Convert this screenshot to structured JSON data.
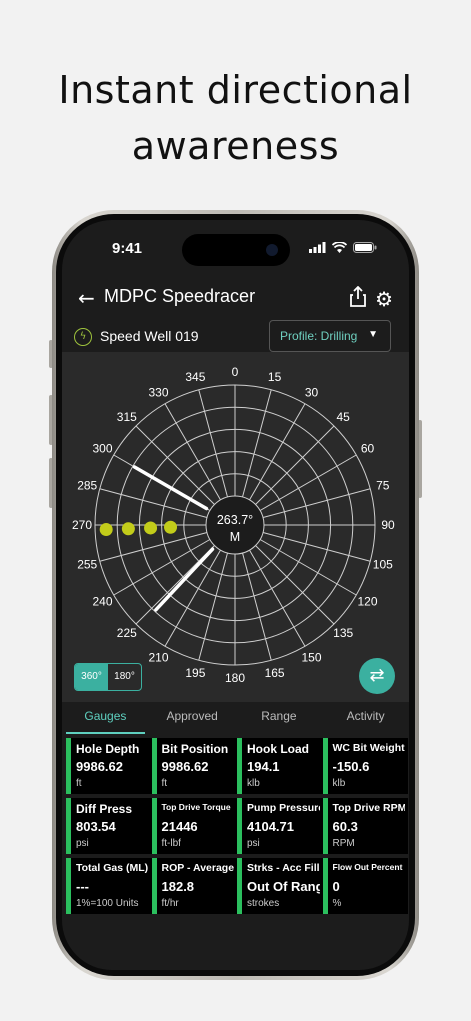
{
  "headline": {
    "line1": "Instant directional",
    "line2": "awareness"
  },
  "status": {
    "time": "9:41"
  },
  "appbar": {
    "back_icon": "arrow-left-icon",
    "title": "MDPC Speedracer",
    "share_icon": "share-icon",
    "settings_icon": "gear-icon"
  },
  "well": {
    "icon": "bolt-icon",
    "name": "Speed Well 019"
  },
  "profile": {
    "label": "Profile: Drilling"
  },
  "polar": {
    "angles": [
      "0",
      "15",
      "30",
      "45",
      "60",
      "75",
      "90",
      "105",
      "120",
      "135",
      "150",
      "165",
      "180",
      "195",
      "210",
      "225",
      "240",
      "255",
      "270",
      "285",
      "300",
      "315",
      "330",
      "345"
    ],
    "center_value": "263.7°",
    "center_label": "M",
    "line_angles_deg": [
      300,
      223
    ],
    "dots_azimuth_deg": [
      268,
      268,
      268,
      268
    ],
    "dots_radius_frac": [
      0.32,
      0.5,
      0.7,
      0.9
    ],
    "dot_color": "#c2cc1a",
    "accent": "#3bb0a0"
  },
  "mode_toggle": {
    "options": [
      "360°",
      "180°"
    ],
    "selected": "360°"
  },
  "swap_icon": "swap-arrows-icon",
  "tabs": [
    {
      "label": "Gauges",
      "active": true
    },
    {
      "label": "Approved Surveys",
      "active": false
    },
    {
      "label": "Range",
      "active": false
    },
    {
      "label": "Activity",
      "active": false
    }
  ],
  "gauges": [
    [
      {
        "label": "Hole Depth",
        "value": "9986.62",
        "unit": "ft",
        "size": "l"
      },
      {
        "label": "Bit Position",
        "value": "9986.62",
        "unit": "ft",
        "size": "l"
      },
      {
        "label": "Hook Load",
        "value": "194.1",
        "unit": "klb",
        "size": "l"
      },
      {
        "label": "WC Bit Weight",
        "value": "-150.6",
        "unit": "klb",
        "size": "m"
      }
    ],
    [
      {
        "label": "Diff Press",
        "value": "803.54",
        "unit": "psi",
        "size": "l"
      },
      {
        "label": "Top Drive Torque",
        "value": "21446",
        "unit": "ft-lbf",
        "size": "s"
      },
      {
        "label": "Pump Pressure",
        "value": "4104.71",
        "unit": "psi",
        "size": "m"
      },
      {
        "label": "Top Drive RPM",
        "value": "60.3",
        "unit": "RPM",
        "size": "m"
      }
    ],
    [
      {
        "label": "Total Gas (ML)",
        "value": "---",
        "unit": "1%=100 Units",
        "size": "m"
      },
      {
        "label": "ROP - Average",
        "value": "182.8",
        "unit": "ft/hr",
        "size": "m"
      },
      {
        "label": "Strks - Acc Fill",
        "value": "Out Of Range",
        "unit": "strokes",
        "size": "m"
      },
      {
        "label": "Flow Out Percent",
        "value": "0",
        "unit": "%",
        "size": "s"
      }
    ]
  ]
}
